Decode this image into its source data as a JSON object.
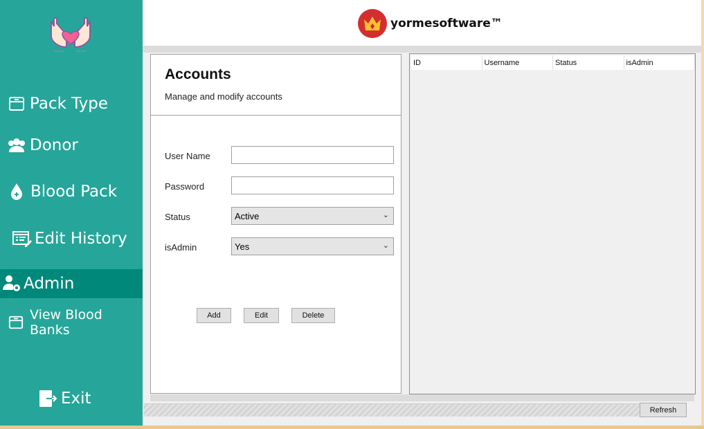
{
  "sidebar": {
    "items": [
      {
        "label": "Pack Type",
        "icon": "box-icon"
      },
      {
        "label": "Donor",
        "icon": "users-icon"
      },
      {
        "label": "Blood Pack",
        "icon": "blood-drop-icon"
      },
      {
        "label": "Edit History",
        "icon": "edit-list-icon"
      },
      {
        "label": "Admin",
        "icon": "user-gear-icon",
        "active": true
      },
      {
        "label": "View Blood Banks",
        "icon": "box-icon"
      }
    ],
    "exit": "Exit"
  },
  "header": {
    "brand": "yormesoftware™"
  },
  "form": {
    "title": "Accounts",
    "subtitle": "Manage and modify accounts",
    "username_label": "User Name",
    "username_value": "",
    "password_label": "Password",
    "password_value": "",
    "status_label": "Status",
    "status_value": "Active",
    "isadmin_label": "isAdmin",
    "isadmin_value": "Yes",
    "add": "Add",
    "edit": "Edit",
    "delete": "Delete"
  },
  "table": {
    "columns": [
      "ID",
      "Username",
      "Status",
      "isAdmin"
    ],
    "rows": []
  },
  "footer": {
    "refresh": "Refresh"
  },
  "colors": {
    "sidebar": "#26a69a",
    "active": "#00897b"
  }
}
